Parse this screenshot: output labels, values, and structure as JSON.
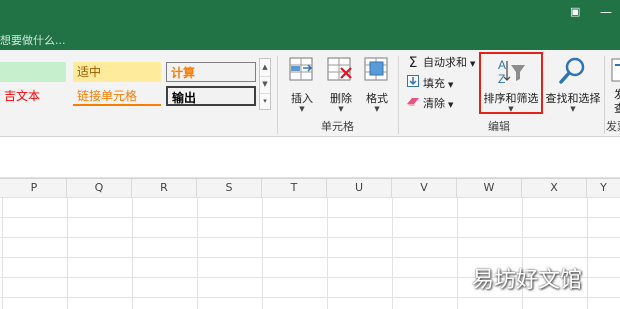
{
  "tell_me": {
    "text": "想要做什么..."
  },
  "styles": {
    "row1": [
      {
        "label": "",
        "bg": "#c6efce",
        "color": "#006100"
      },
      {
        "label": "适中",
        "bg": "#ffeb9c",
        "color": "#9c5700"
      },
      {
        "label": "计算",
        "bg": "#f2f2f2",
        "color": "#fa7d00"
      }
    ],
    "row2": [
      {
        "label": "吉文本",
        "color": "#ff0000"
      },
      {
        "label": "链接单元格",
        "color": "#fa7d00"
      },
      {
        "label": "输出",
        "color": "#000000"
      }
    ]
  },
  "cells_group": {
    "insert_label": "插入",
    "delete_label": "删除",
    "format_label": "格式",
    "group_label": "单元格"
  },
  "editing_group": {
    "autosum_label": "自动求和",
    "fill_label": "填充",
    "clear_label": "清除",
    "sort_filter_label": "排序和筛选",
    "find_select_label": "查找和选择",
    "group_label": "编辑"
  },
  "partial_group": {
    "button_label_1": "发",
    "button_label_2": "查",
    "group_label": "发票"
  },
  "columns": [
    "P",
    "Q",
    "R",
    "S",
    "T",
    "U",
    "V",
    "W",
    "X",
    "Y"
  ],
  "colors": {
    "accent": "#217346",
    "highlight": "#e3231a"
  },
  "watermark": "易坊好文馆"
}
